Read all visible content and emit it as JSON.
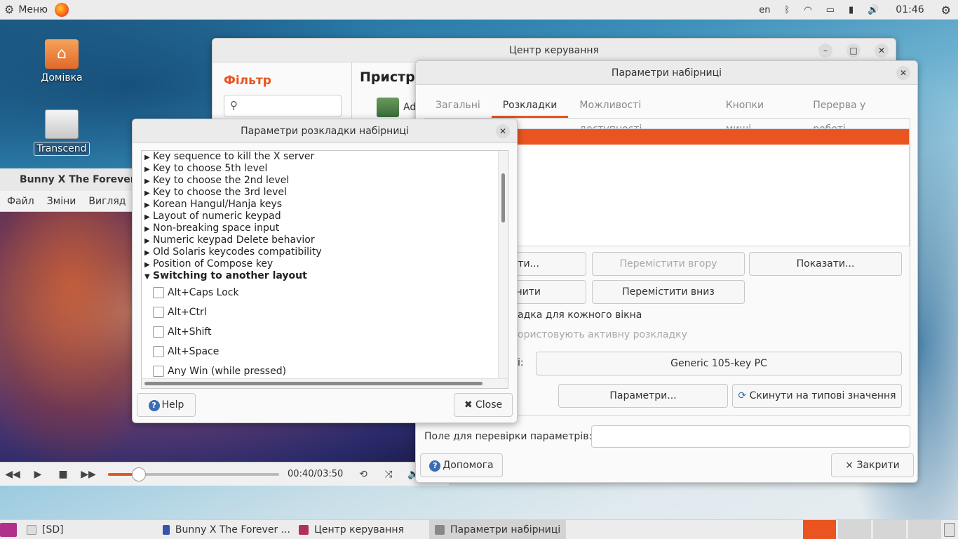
{
  "top_panel": {
    "menu_label": "Меню",
    "tray": {
      "language": "en",
      "clock": "01:46"
    }
  },
  "desktop": {
    "icons": [
      {
        "label": "Домівка"
      },
      {
        "label": "Transcend"
      }
    ]
  },
  "media_player": {
    "title": "Bunny X The Forever W",
    "menu": [
      "Файл",
      "Зміни",
      "Вигляд"
    ],
    "time": "00:40/03:50",
    "progress": 0.18
  },
  "control_center": {
    "title": "Центр керування",
    "filter_label": "Фільтр",
    "heading": "Пристр",
    "item_text": "Ad"
  },
  "keyboard_prefs": {
    "title": "Параметри набірниці",
    "tabs": [
      "Загальні",
      "Розкладки",
      "Можливості доступності",
      "Кнопки миші",
      "Перерва у роботі"
    ],
    "active_tab": 1,
    "buttons": {
      "add": "ати...",
      "move_up": "Перемістити вгору",
      "show": "Показати...",
      "remove": "нити",
      "move_down": "Перемістити вниз",
      "options": "Параметри...",
      "reset": "Скинути на типові значення",
      "help": "Допомога",
      "close": "Закрити"
    },
    "per_window_label": "адка для кожного вікна",
    "active_layout_label": "ористовують активну розкладку",
    "model_label": "і:",
    "model_value": "Generic 105-key PC",
    "test_field_label": "Поле для перевірки параметрів:",
    "test_field_value": ""
  },
  "layout_options": {
    "title": "Параметри розкладки набірниці",
    "tree": [
      {
        "label": "Key sequence to kill the X server",
        "expanded": false
      },
      {
        "label": "Key to choose 5th level",
        "expanded": false
      },
      {
        "label": "Key to choose the 2nd level",
        "expanded": false
      },
      {
        "label": "Key to choose the 3rd level",
        "expanded": false
      },
      {
        "label": "Korean Hangul/Hanja keys",
        "expanded": false
      },
      {
        "label": "Layout of numeric keypad",
        "expanded": false
      },
      {
        "label": "Non-breaking space input",
        "expanded": false
      },
      {
        "label": "Numeric keypad Delete behavior",
        "expanded": false
      },
      {
        "label": "Old Solaris keycodes compatibility",
        "expanded": false
      },
      {
        "label": "Position of Compose key",
        "expanded": false
      },
      {
        "label": "Switching to another layout",
        "expanded": true
      }
    ],
    "options": [
      {
        "label": "Alt+Caps Lock",
        "checked": false
      },
      {
        "label": "Alt+Ctrl",
        "checked": false
      },
      {
        "label": "Alt+Shift",
        "checked": false
      },
      {
        "label": "Alt+Space",
        "checked": false
      },
      {
        "label": "Any Win (while pressed)",
        "checked": false
      }
    ],
    "help_label": "Help",
    "close_label": "Close"
  },
  "taskbar": {
    "items": [
      {
        "label": "[SD]"
      },
      {
        "label": "Bunny X The Forever ..."
      },
      {
        "label": "Центр керування"
      },
      {
        "label": "Параметри набірниці"
      }
    ]
  },
  "colors": {
    "accent": "#e95420"
  }
}
